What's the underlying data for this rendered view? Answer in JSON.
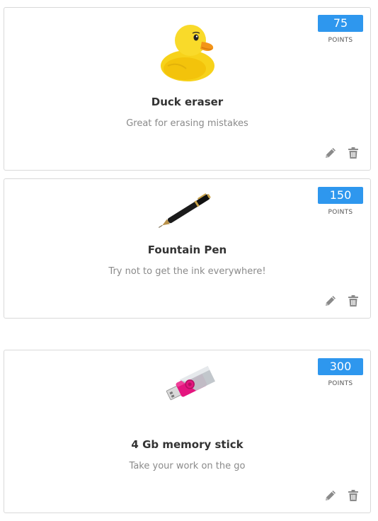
{
  "items": [
    {
      "name": "Duck eraser",
      "description": "Great for erasing mistakes",
      "points": "75",
      "points_label": "POINTS",
      "image": "rubber-duck"
    },
    {
      "name": "Fountain Pen",
      "description": "Try not to get the ink everywhere!",
      "points": "150",
      "points_label": "POINTS",
      "image": "fountain-pen"
    },
    {
      "name": "4 Gb memory stick",
      "description": "Take your work on the go",
      "points": "300",
      "points_label": "POINTS",
      "image": "usb-memory-stick"
    }
  ],
  "icons": {
    "edit": "pencil-icon",
    "delete": "trash-icon"
  },
  "colors": {
    "badge": "#2e97ee",
    "icon": "#8a8a8a",
    "border": "#d9d9d9"
  }
}
